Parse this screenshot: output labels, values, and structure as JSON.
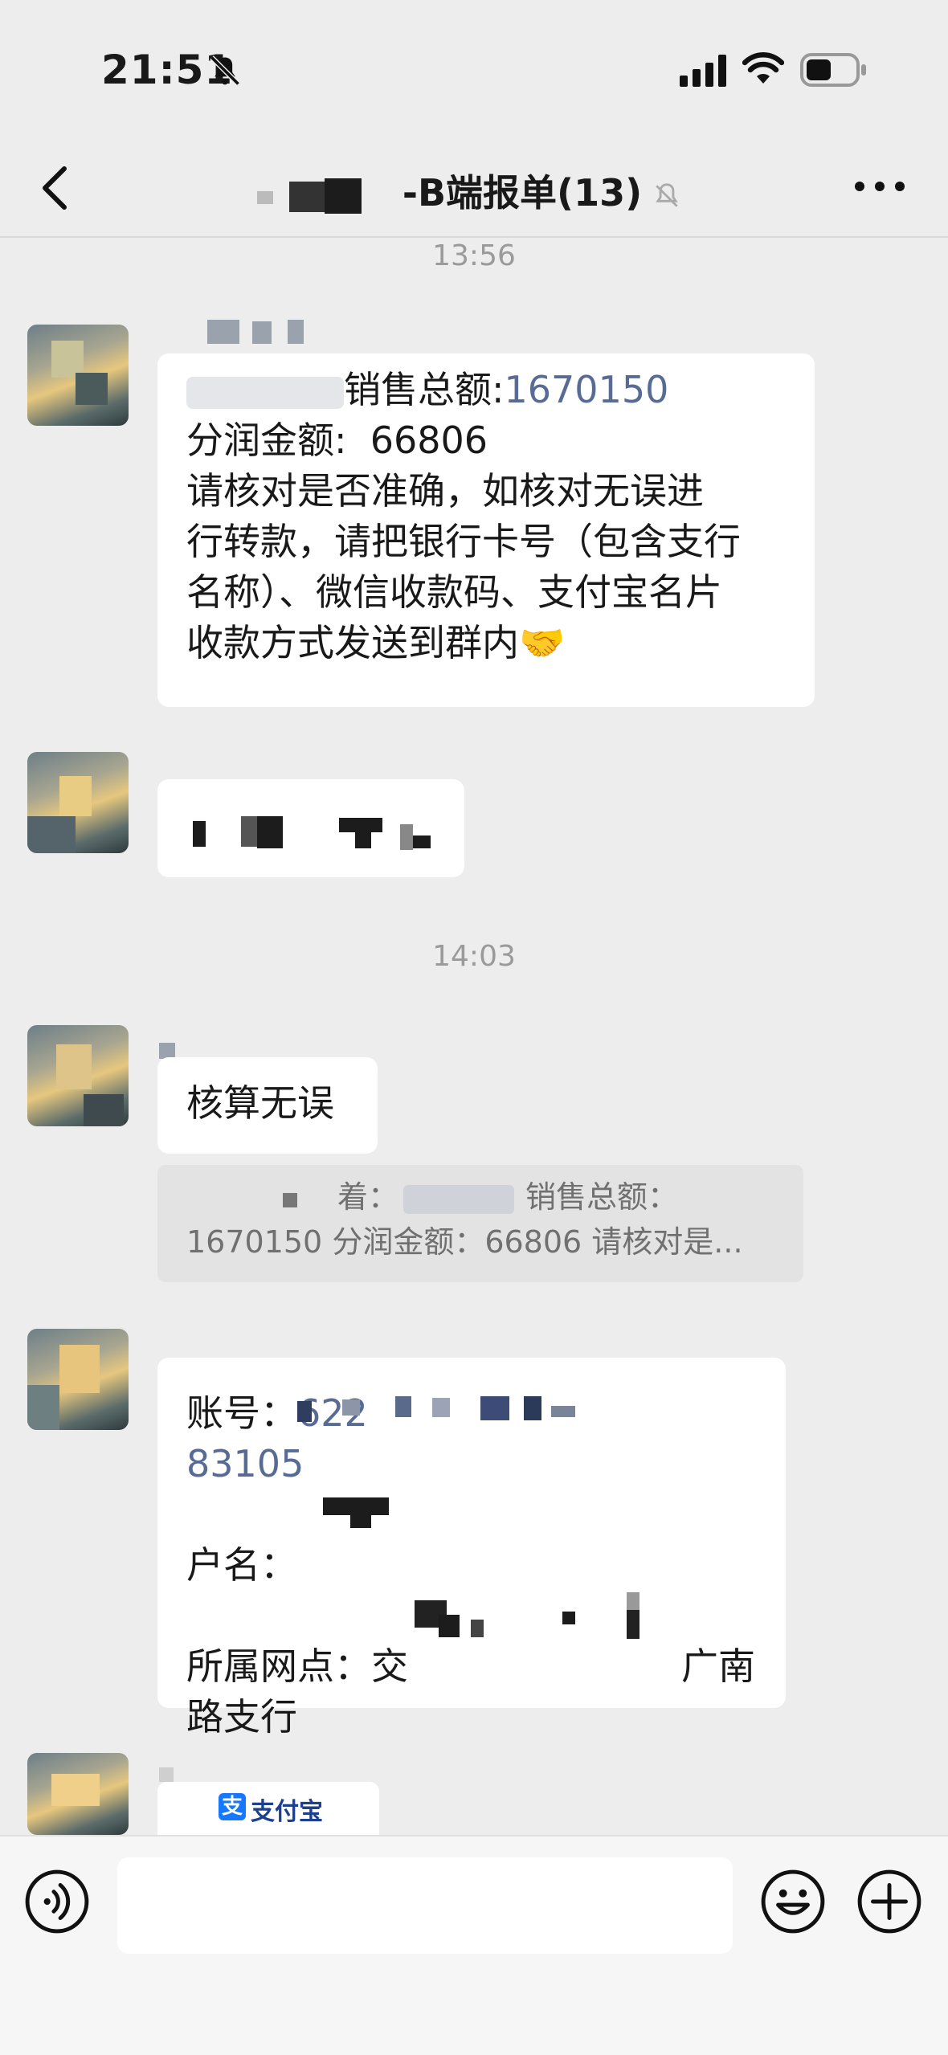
{
  "status_bar": {
    "time": "21:51"
  },
  "header": {
    "title": "-B端报单(13)"
  },
  "timestamps": [
    "13:56",
    "14:03"
  ],
  "messages": {
    "msg1": {
      "line1_label": "销售总额:",
      "line1_value": "1670150",
      "line2": "分润金额:  66806",
      "line3": "请核对是否准确，如核对无误进",
      "line4": "行转款，请把银行卡号（包含支行",
      "line5": "名称）、微信收款码、支付宝名片",
      "line6": "收款方式发送到群内",
      "emoji": "🤝"
    },
    "msg3": {
      "text": "核算无误"
    },
    "quote": {
      "line1_a": "着：",
      "line1_b": "销售总额：",
      "line2": "1670150 分润金额：66806 请核对是..."
    },
    "msg4": {
      "account_label": "账号：",
      "account_prefix": "622",
      "account_suffix": "83105",
      "name_label": "户名：",
      "branch_label": "所属网点：交",
      "branch_mid": "广南",
      "branch_line2": "路支行"
    },
    "msg5": {
      "brand": "支付宝",
      "brand_mark": "支"
    }
  },
  "colors": {
    "background": "#ededed",
    "bubble": "#ffffff",
    "timestamp": "#9a9a9a",
    "number": "#576b95"
  }
}
